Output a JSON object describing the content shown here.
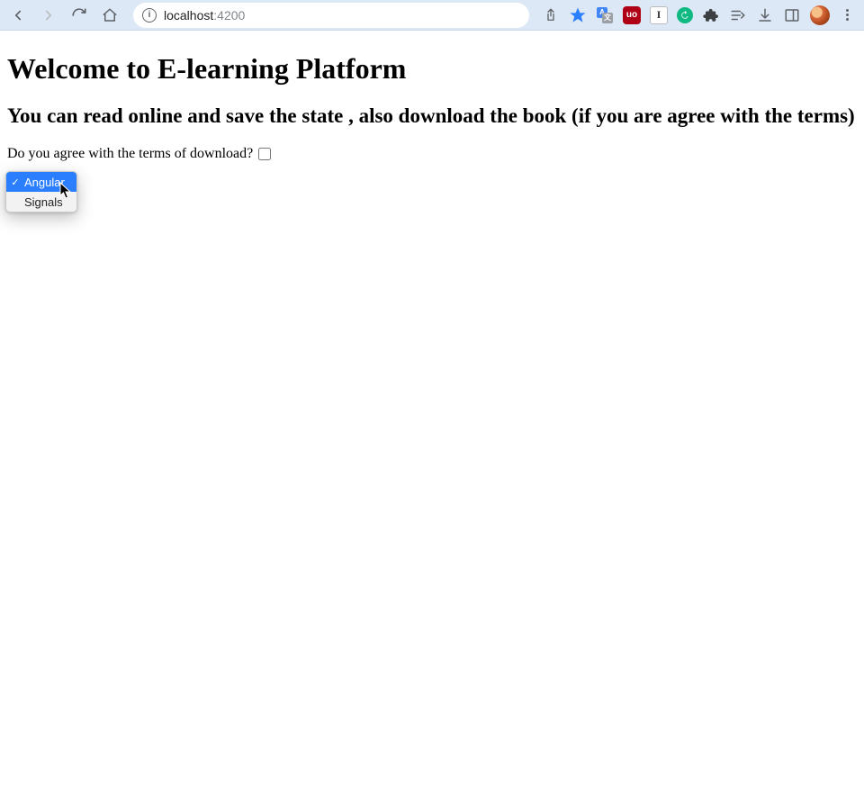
{
  "browser": {
    "url_host": "localhost",
    "url_port": ":4200",
    "ublock_label": "uo",
    "ext_i_label": "I",
    "translate_a": "A",
    "translate_b": "文"
  },
  "page": {
    "heading": "Welcome to E-learning Platform",
    "subheading": "You can read online and save the state , also download the book (if you are agree with the terms)",
    "terms_label": "Do you agree with the terms of download?"
  },
  "dropdown": {
    "options": [
      {
        "label": "Angular",
        "selected": true
      },
      {
        "label": "Signals",
        "selected": false
      }
    ]
  },
  "checkbox": {
    "checked": false
  }
}
